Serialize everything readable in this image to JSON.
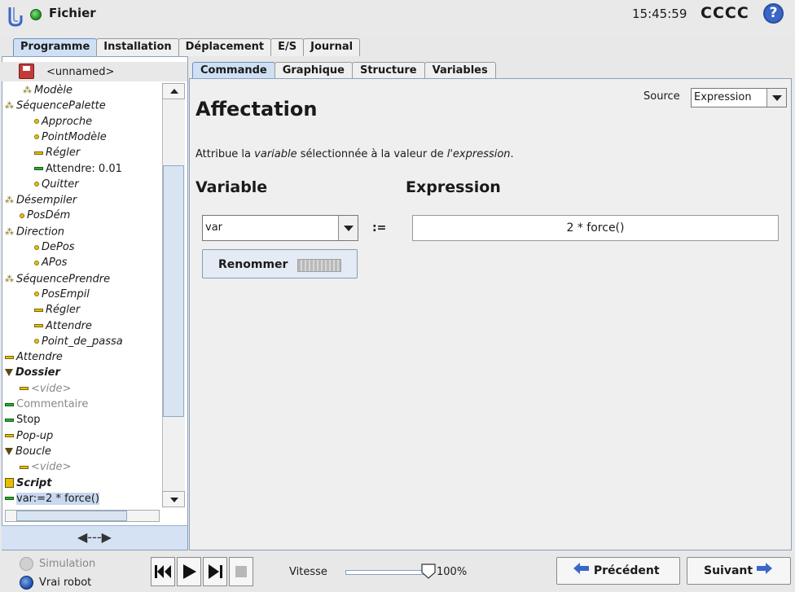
{
  "header": {
    "file_label": "Fichier",
    "clock": "15:45:59",
    "robot_name": "CCCC",
    "help": "?"
  },
  "main_tabs": [
    {
      "label": "Programme",
      "active": true
    },
    {
      "label": "Installation",
      "active": false
    },
    {
      "label": "Déplacement",
      "active": false
    },
    {
      "label": "E/S",
      "active": false
    },
    {
      "label": "Journal",
      "active": false
    }
  ],
  "program": {
    "name": "<unnamed>"
  },
  "tree": [
    {
      "label": "Modèle",
      "style": "it",
      "icon": "dots"
    },
    {
      "label": "SéquencePalette",
      "style": "it",
      "icon": "dots"
    },
    {
      "label": "Approche",
      "style": "it",
      "icon": "waypoint"
    },
    {
      "label": "PointModèle",
      "style": "it",
      "icon": "waypoint"
    },
    {
      "label": "Régler",
      "style": "it",
      "icon": "bar-yellow"
    },
    {
      "label": "Attendre: 0.01",
      "style": "",
      "icon": "bar-green"
    },
    {
      "label": "Quitter",
      "style": "it",
      "icon": "waypoint"
    },
    {
      "label": "Désempiler",
      "style": "it",
      "icon": "dots"
    },
    {
      "label": "PosDém",
      "style": "it",
      "icon": "waypoint"
    },
    {
      "label": "Direction",
      "style": "it",
      "icon": "dots"
    },
    {
      "label": "DePos",
      "style": "it",
      "icon": "waypoint"
    },
    {
      "label": "APos",
      "style": "it",
      "icon": "waypoint"
    },
    {
      "label": "SéquencePrendre",
      "style": "it",
      "icon": "dots"
    },
    {
      "label": "PosEmpil",
      "style": "it",
      "icon": "waypoint"
    },
    {
      "label": "Régler",
      "style": "it",
      "icon": "bar-yellow"
    },
    {
      "label": "Attendre",
      "style": "it",
      "icon": "bar-yellow"
    },
    {
      "label": "Point_de_passa",
      "style": "it",
      "icon": "waypoint"
    },
    {
      "label": "Attendre",
      "style": "it",
      "icon": "bar-yellow"
    },
    {
      "label": "Dossier",
      "style": "it bd",
      "icon": "triangle"
    },
    {
      "label": "<vide>",
      "style": "it gray",
      "icon": "bar-yellow"
    },
    {
      "label": "Commentaire",
      "style": "gray",
      "icon": "bar-green"
    },
    {
      "label": "Stop",
      "style": "",
      "icon": "bar-green"
    },
    {
      "label": "Pop-up",
      "style": "it",
      "icon": "bar-yellow"
    },
    {
      "label": "Boucle",
      "style": "it",
      "icon": "triangle"
    },
    {
      "label": "<vide>",
      "style": "it gray",
      "icon": "bar-yellow"
    },
    {
      "label": "Script",
      "style": "it bd",
      "icon": "script"
    },
    {
      "label": "var:=2 * force()",
      "style": "sel",
      "icon": "bar-green"
    }
  ],
  "sub_tabs": [
    {
      "label": "Commande",
      "active": true
    },
    {
      "label": "Graphique",
      "active": false
    },
    {
      "label": "Structure",
      "active": false
    },
    {
      "label": "Variables",
      "active": false
    }
  ],
  "command": {
    "title": "Affectation",
    "source_label": "Source",
    "source_value": "Expression",
    "desc_pre": "Attribue la ",
    "desc_var": "variable",
    "desc_mid": " sélectionnée à la valeur de ",
    "desc_expr": "l'expression",
    "desc_end": ".",
    "variable_heading": "Variable",
    "expression_heading": "Expression",
    "variable_value": "var",
    "assign_operator": ":=",
    "expression_value": "2 * force()",
    "rename_label": "Renommer"
  },
  "bottom": {
    "simulation_label": "Simulation",
    "real_robot_label": "Vrai robot",
    "speed_label": "Vitesse",
    "speed_value": "100%",
    "speed_fraction": 1.0,
    "prev_label": "Précédent",
    "next_label": "Suivant"
  },
  "colors": {
    "accent": "#cfe0f5",
    "tab_border": "#6f8fb8",
    "selection": "#c7d8ef"
  }
}
